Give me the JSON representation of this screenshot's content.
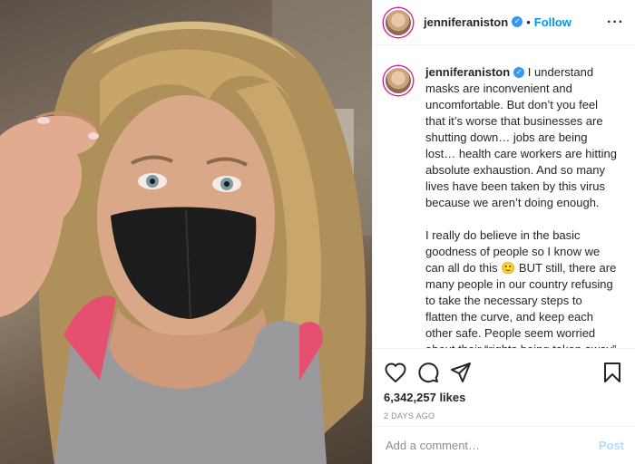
{
  "post": {
    "username": "jenniferaniston",
    "verified_icon": "verified-badge-icon",
    "dot": "•",
    "follow_label": "Follow",
    "more_label": "···",
    "caption_username": "jenniferaniston",
    "caption_body": " I understand masks are inconvenient and uncomfortable. But don’t you feel that it’s worse that businesses are shutting down… jobs are being lost… health care workers are hitting absolute exhaustion. And so many lives have been taken by this virus because we aren’t doing enough.\n\nI really do believe in the basic goodness of people so I know we can all do this 🙂 BUT still, there are many people in our country refusing to take the necessary steps to flatten the curve, and keep each other safe. People seem worried about their “rights being taken away” by being asked to wear a mask. This simple and effective recommendation is being",
    "likes": "6,342,257 likes",
    "time_ago": "2 DAYS AGO"
  },
  "comment": {
    "placeholder": "Add a comment…",
    "post_label": "Post"
  },
  "colors": {
    "accent": "#0095f6",
    "verified": "#3897f0",
    "border": "#efefef",
    "muted": "#8e8e8e"
  }
}
